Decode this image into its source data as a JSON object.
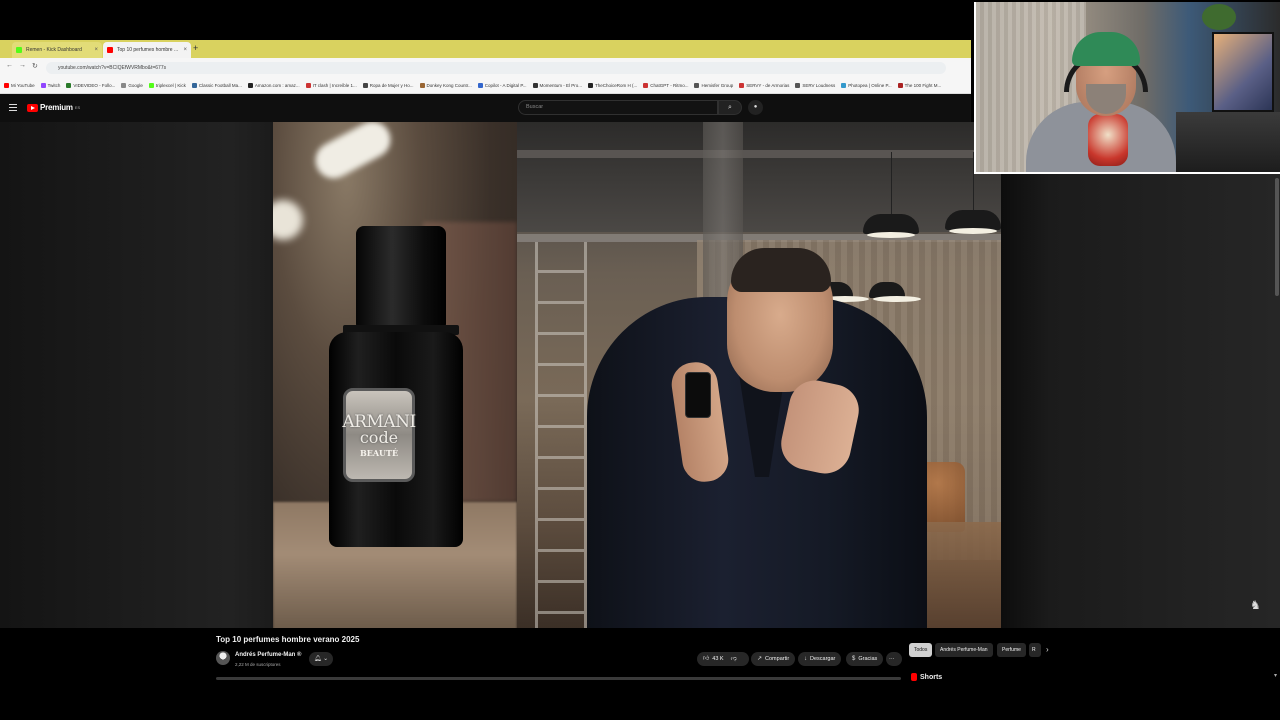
{
  "browser": {
    "tabs": [
      {
        "title": "Remen - Kick Dashboard",
        "favicon_color": "#53fc18"
      },
      {
        "title": "Top 10 perfumes hombre ...",
        "favicon_color": "#ff0000"
      }
    ],
    "new_tab": "+",
    "url": "youtube.com/watch?v=BCIQEfWVRMbo&t=677s",
    "bookmarks": [
      {
        "label": "Mi YouTube",
        "color": "#ff0000"
      },
      {
        "label": "Twitch",
        "color": "#9146ff"
      },
      {
        "label": "VIDEVIDEO - Follo...",
        "color": "#2a7a2a"
      },
      {
        "label": "Google",
        "color": "#888888"
      },
      {
        "label": "triplexcel | Kick",
        "color": "#53fc18"
      },
      {
        "label": "Classic Football Ma...",
        "color": "#336699"
      },
      {
        "label": "Amazon.com : amaz...",
        "color": "#222222"
      },
      {
        "label": "IT clash | Increíble 1...",
        "color": "#cc3333"
      },
      {
        "label": "Ropa de Mujer y Ho...",
        "color": "#444444"
      },
      {
        "label": "Donkey Kong Countr...",
        "color": "#996633"
      },
      {
        "label": "Copilot - A Digital P...",
        "color": "#3366cc"
      },
      {
        "label": "Momentum - El Pro...",
        "color": "#333333"
      },
      {
        "label": "TheChoiceRom H (...",
        "color": "#222222"
      },
      {
        "label": "ChatGPT - Ritmo...",
        "color": "#cc3333"
      },
      {
        "label": "Hemisfer Group",
        "color": "#555555"
      },
      {
        "label": "SERVY - de Armorias",
        "color": "#cc3333"
      },
      {
        "label": "SERV Loudness",
        "color": "#555555"
      },
      {
        "label": "Photopea | Online P...",
        "color": "#3399cc"
      },
      {
        "label": "The 100 Fight M...",
        "color": "#aa2222"
      }
    ]
  },
  "youtube": {
    "logo_text": "Premium",
    "logo_sup": "ES",
    "search_placeholder": "Buscar",
    "video_title": "Top 10 perfumes hombre verano 2025",
    "channel_name": "Andrés Perfume-Man ®",
    "subscribers": "2,22 M de suscriptores",
    "likes": "43 K",
    "share_label": "Compartir",
    "download_label": "Descargar",
    "thanks_label": "Gracias",
    "more_label": "···",
    "chips": [
      "Todos",
      "Andrés Perfume-Man",
      "Perfume",
      "R"
    ],
    "shorts_label": "Shorts"
  },
  "video": {
    "bottle_label": [
      "ARMANI",
      "code",
      "BEAUTÉ"
    ]
  }
}
